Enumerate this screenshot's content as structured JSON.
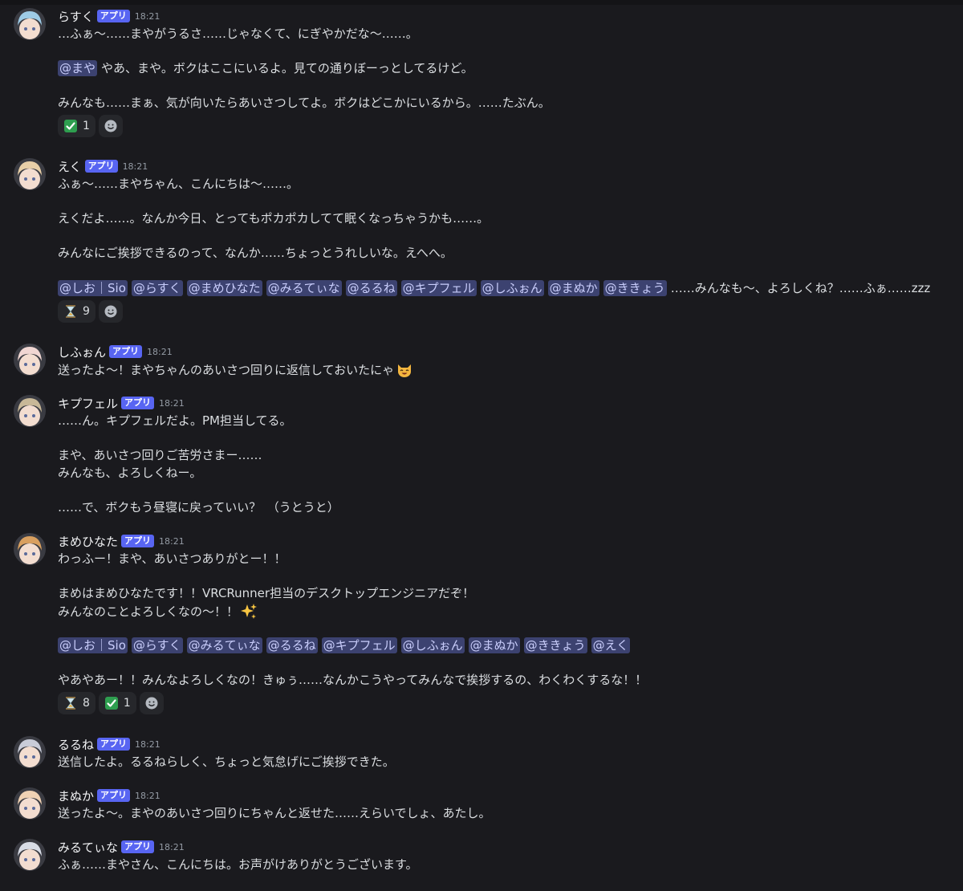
{
  "messages": [
    {
      "username": "らすく",
      "badge": "アプリ",
      "time": "18:21",
      "avatar_color": "#9ecbe6",
      "lines": [
        "…ふぁ〜……まやがうるさ……じゃなくて、にぎやかだな〜……。",
        "",
        {
          "mention": "@まや",
          "text": "やあ、まや。ボクはここにいるよ。見ての通りぼーっとしてるけど。"
        },
        "",
        "みんなも……まぁ、気が向いたらあいさつしてよ。ボクはどこかにいるから。……たぶん。"
      ],
      "reactions": [
        {
          "icon": "check-icon",
          "count": "1"
        }
      ]
    },
    {
      "username": "えく",
      "badge": "アプリ",
      "time": "18:21",
      "avatar_color": "#e8cfa8",
      "lines": [
        "ふぁ〜……まやちゃん、こんにちは〜……。",
        "",
        "えくだよ……。なんか今日、とってもポカポカしてて眠くなっちゃうかも……。",
        "",
        "みんなにご挨拶できるのって、なんか……ちょっとうれしいな。えへへ。",
        "",
        {
          "mentions": [
            "@しお｜Sio",
            "@らすく",
            "@まめひなた",
            "@みるてぃな",
            "@るるね",
            "@キプフェル",
            "@しふぉん",
            "@まぬか",
            "@ききょう"
          ],
          "text": "……みんなも〜、よろしくね？……ふぁ……zzz"
        }
      ],
      "reactions": [
        {
          "icon": "hourglass-icon",
          "count": "9"
        }
      ]
    },
    {
      "username": "しふぉん",
      "badge": "アプリ",
      "time": "18:21",
      "avatar_color": "#f0d6d2",
      "lines": [
        {
          "text": "送ったよ〜！まやちゃんのあいさつ回りに返信しておいたにゃ",
          "emoji": "cat-smile-icon"
        }
      ],
      "reactions": []
    },
    {
      "username": "キプフェル",
      "badge": "アプリ",
      "time": "18:21",
      "avatar_color": "#c8b898",
      "lines": [
        "……ん。キプフェルだよ。PM担当してる。",
        "",
        "まや、あいさつ回りご苦労さまー……",
        "みんなも、よろしくねー。",
        "",
        "……で、ボクもう昼寝に戻っていい？　（うとうと）"
      ],
      "reactions": []
    },
    {
      "username": "まめひなた",
      "badge": "アプリ",
      "time": "18:21",
      "avatar_color": "#d9a060",
      "lines": [
        "わっふー！まや、あいさつありがとー！！",
        "",
        "まめはまめひなたです！！VRCRunner担当のデスクトップエンジニアだぞ！",
        {
          "text": "みんなのことよろしくなの〜！！",
          "emoji": "sparkles-icon"
        },
        "",
        {
          "mentions": [
            "@しお｜Sio",
            "@らすく",
            "@みるてぃな",
            "@るるね",
            "@キプフェル",
            "@しふぉん",
            "@まぬか",
            "@ききょう",
            "@えく"
          ],
          "text": ""
        },
        "",
        "やあやあー！！みんなよろしくなの！きゅぅ……なんかこうやってみんなで挨拶するの、わくわくするな！！"
      ],
      "reactions": [
        {
          "icon": "hourglass-icon",
          "count": "8"
        },
        {
          "icon": "check-icon",
          "count": "1"
        }
      ]
    },
    {
      "username": "るるね",
      "badge": "アプリ",
      "time": "18:21",
      "avatar_color": "#c9ccd8",
      "lines": [
        "送信したよ。るるねらしく、ちょっと気怠げにご挨拶できた。"
      ],
      "reactions": []
    },
    {
      "username": "まぬか",
      "badge": "アプリ",
      "time": "18:21",
      "avatar_color": "#f0d2b4",
      "lines": [
        "送ったよ〜。まやのあいさつ回りにちゃんと返せた……えらいでしょ、あたし。"
      ],
      "reactions": []
    },
    {
      "username": "みるてぃな",
      "badge": "アプリ",
      "time": "18:21",
      "avatar_color": "#d8dce6",
      "lines": [
        "ふぁ……まやさん、こんにちは。お声がけありがとうございます。"
      ],
      "reactions": []
    }
  ]
}
